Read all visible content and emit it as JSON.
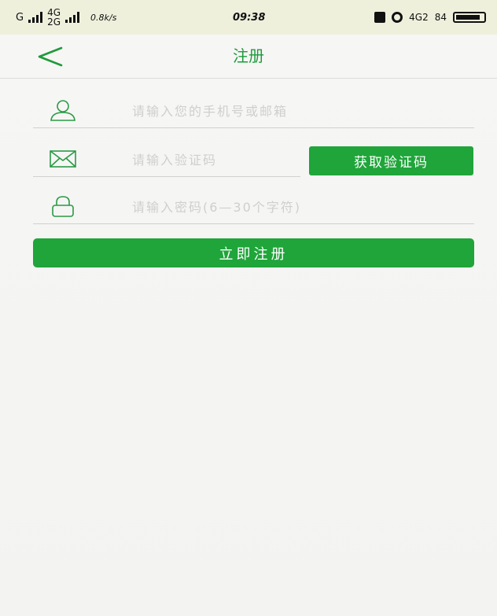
{
  "status_bar": {
    "carrier": "G",
    "network_top": "4G",
    "network_bottom": "2G",
    "speed": "0.8k/s",
    "time": "09:38",
    "network_right": "4G2",
    "battery": "84"
  },
  "header": {
    "title": "注册",
    "back_icon": "chevron-left-icon",
    "accent_color": "#1d9a3c"
  },
  "form": {
    "account_placeholder": "请输入您的手机号或邮箱",
    "account_icon": "user-icon",
    "code_placeholder": "请输入验证码",
    "code_icon": "envelope-icon",
    "get_code_label": "获取验证码",
    "password_placeholder": "请输入密码(6—30个字符)",
    "password_icon": "lock-icon",
    "submit_label": "立即注册",
    "button_color": "#1fa53a"
  }
}
